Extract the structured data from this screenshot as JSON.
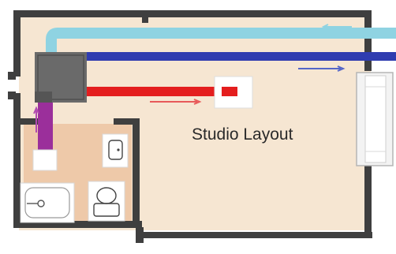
{
  "diagram": {
    "title": "Studio Layout",
    "colors": {
      "wall": "#3f3f3f",
      "floor": "#f6e6d2",
      "bathroom_floor": "#eec9a9",
      "return_duct": "#8fd3e2",
      "supply_duct": "#2f3cb0",
      "hot_duct": "#e41e1e",
      "exhaust_duct": "#9b2f9b",
      "unit": "#6a6a6a",
      "window": "#eeeeee"
    },
    "icons": [
      "ventilation-unit-icon",
      "ceiling-vent-icon",
      "sink-icon",
      "toilet-icon",
      "bathtub-icon",
      "window-icon",
      "airflow-arrow-icon"
    ]
  }
}
